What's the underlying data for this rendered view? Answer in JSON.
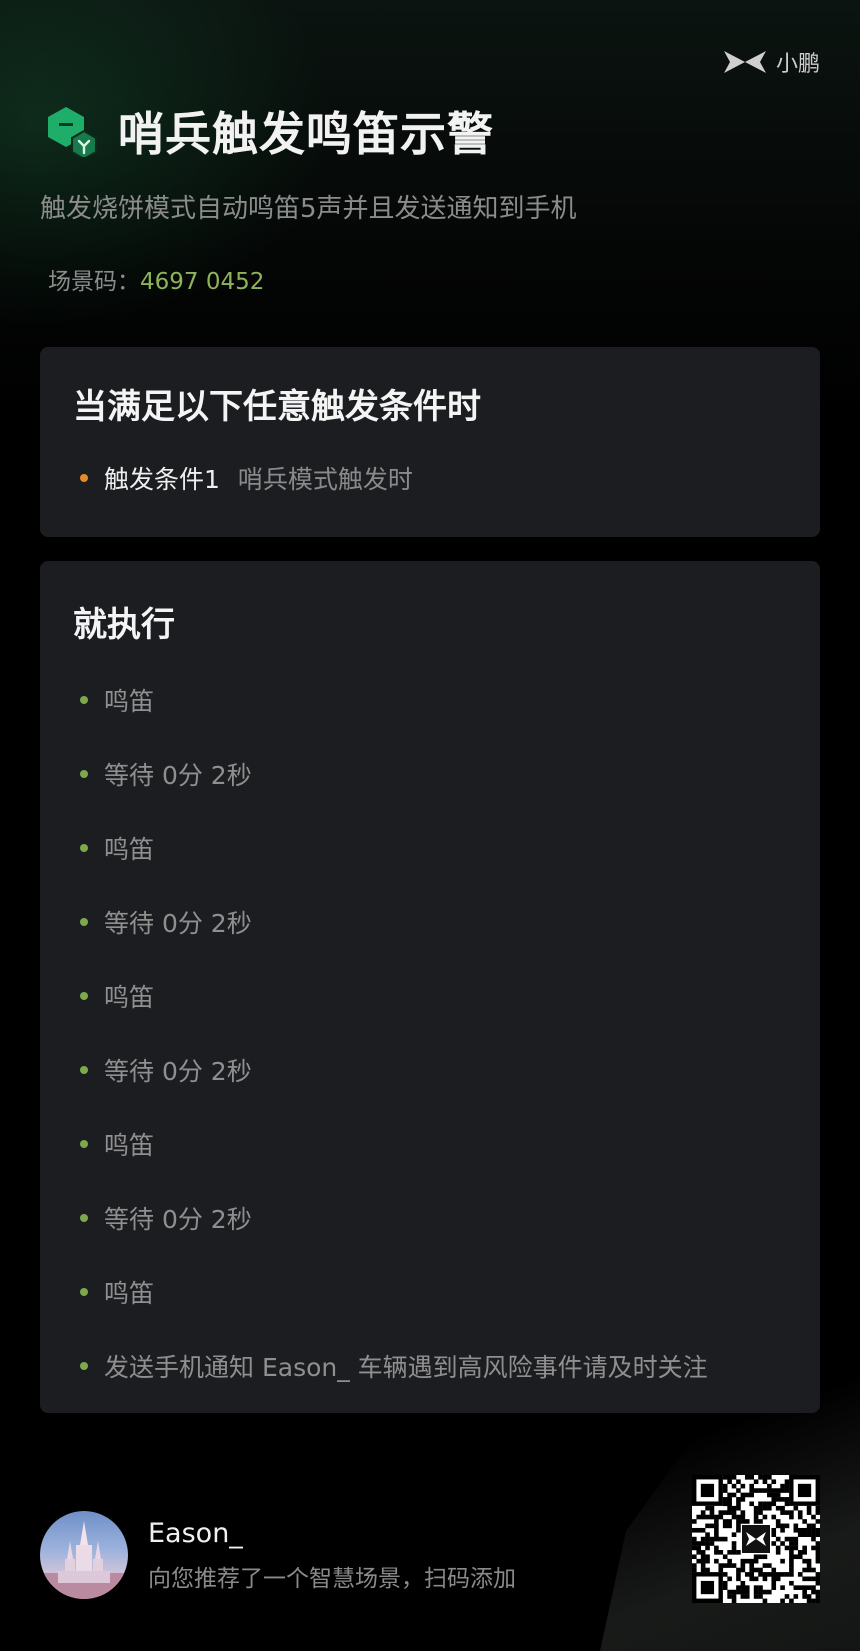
{
  "brand": {
    "logo_icon": "xpeng-logo-icon",
    "name": "小鹏"
  },
  "header": {
    "icon": "scene-cube-icon",
    "title": "哨兵触发鸣笛示警",
    "subtitle": "触发烧饼模式自动鸣笛5声并且发送通知到手机",
    "scene_code_label": "场景码：",
    "scene_code": "4697 0452"
  },
  "trigger_card": {
    "title": "当满足以下任意触发条件时",
    "items": [
      {
        "name": "触发条件1",
        "desc": "哨兵模式触发时"
      }
    ]
  },
  "action_card": {
    "title": "就执行",
    "items": [
      "鸣笛",
      "等待 0分 2秒",
      "鸣笛",
      "等待 0分 2秒",
      "鸣笛",
      "等待 0分 2秒",
      "鸣笛",
      "等待 0分 2秒",
      "鸣笛",
      "发送手机通知 Eason_ 车辆遇到高风险事件请及时关注"
    ]
  },
  "footer": {
    "avatar": "avatar-castle",
    "user_name": "Eason_",
    "message": "向您推荐了一个智慧场景，扫码添加",
    "qr_icon": "qr-code-icon"
  },
  "colors": {
    "accent_green": "#8fb35a",
    "bullet_orange": "#e88a28",
    "bullet_green": "#7ea94a",
    "card_bg": "#1c1d20"
  }
}
